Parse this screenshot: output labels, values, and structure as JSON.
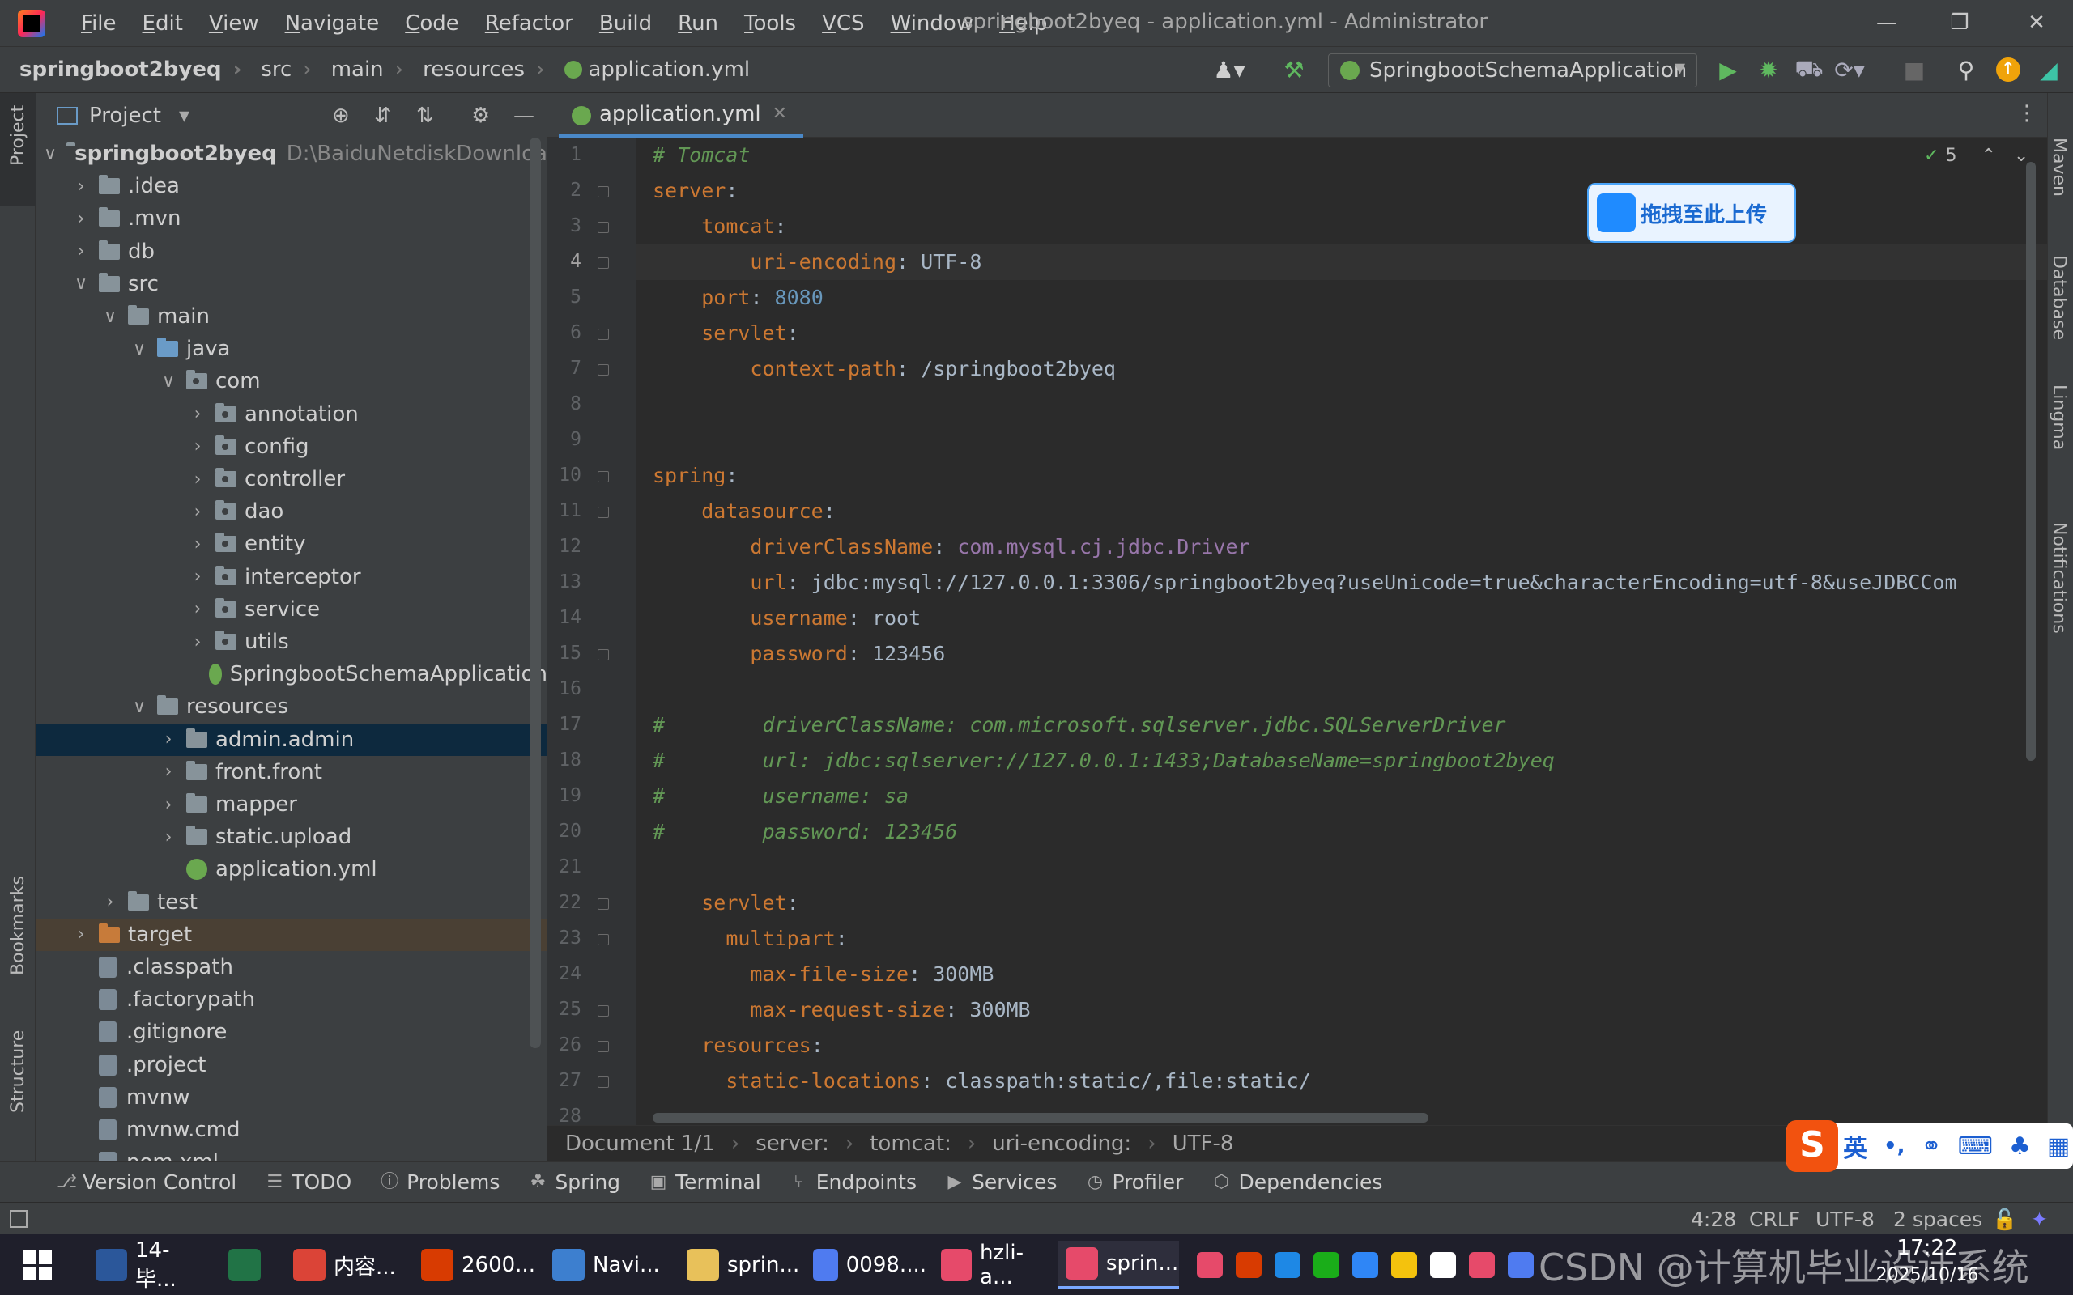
{
  "titlebar": {
    "menu": [
      "File",
      "Edit",
      "View",
      "Navigate",
      "Code",
      "Refactor",
      "Build",
      "Run",
      "Tools",
      "VCS",
      "Window",
      "Help"
    ],
    "title": "springboot2byeq - application.yml - Administrator"
  },
  "navbar": {
    "crumbs": [
      "springboot2byeq",
      "src",
      "main",
      "resources",
      "application.yml"
    ],
    "run_config": "SpringbootSchemaApplication"
  },
  "left_stripe": {
    "project": "Project",
    "bookmarks": "Bookmarks",
    "structure": "Structure"
  },
  "right_stripe": {
    "maven": "Maven",
    "database": "Database",
    "lingma": "Lingma",
    "notifications": "Notifications"
  },
  "project_panel": {
    "title": "Project",
    "tree": [
      {
        "label": "springboot2byeq",
        "extra": "D:\\BaiduNetdiskDownload\\s",
        "depth": 0,
        "expanded": true,
        "kind": "module"
      },
      {
        "label": ".idea",
        "depth": 1,
        "expanded": false,
        "kind": "folder"
      },
      {
        "label": ".mvn",
        "depth": 1,
        "expanded": false,
        "kind": "folder"
      },
      {
        "label": "db",
        "depth": 1,
        "expanded": false,
        "kind": "folder"
      },
      {
        "label": "src",
        "depth": 1,
        "expanded": true,
        "kind": "folder"
      },
      {
        "label": "main",
        "depth": 2,
        "expanded": true,
        "kind": "folder"
      },
      {
        "label": "java",
        "depth": 3,
        "expanded": true,
        "kind": "folder-blue"
      },
      {
        "label": "com",
        "depth": 4,
        "expanded": true,
        "kind": "package"
      },
      {
        "label": "annotation",
        "depth": 5,
        "expanded": false,
        "kind": "package"
      },
      {
        "label": "config",
        "depth": 5,
        "expanded": false,
        "kind": "package"
      },
      {
        "label": "controller",
        "depth": 5,
        "expanded": false,
        "kind": "package"
      },
      {
        "label": "dao",
        "depth": 5,
        "expanded": false,
        "kind": "package"
      },
      {
        "label": "entity",
        "depth": 5,
        "expanded": false,
        "kind": "package"
      },
      {
        "label": "interceptor",
        "depth": 5,
        "expanded": false,
        "kind": "package"
      },
      {
        "label": "service",
        "depth": 5,
        "expanded": false,
        "kind": "package"
      },
      {
        "label": "utils",
        "depth": 5,
        "expanded": false,
        "kind": "package"
      },
      {
        "label": "SpringbootSchemaApplication",
        "depth": 5,
        "kind": "spring"
      },
      {
        "label": "resources",
        "depth": 3,
        "expanded": true,
        "kind": "folder"
      },
      {
        "label": "admin.admin",
        "depth": 4,
        "expanded": false,
        "kind": "folder",
        "selected": true
      },
      {
        "label": "front.front",
        "depth": 4,
        "expanded": false,
        "kind": "folder"
      },
      {
        "label": "mapper",
        "depth": 4,
        "expanded": false,
        "kind": "folder"
      },
      {
        "label": "static.upload",
        "depth": 4,
        "expanded": false,
        "kind": "folder"
      },
      {
        "label": "application.yml",
        "depth": 4,
        "kind": "yml"
      },
      {
        "label": "test",
        "depth": 2,
        "expanded": false,
        "kind": "folder"
      },
      {
        "label": "target",
        "depth": 1,
        "expanded": false,
        "kind": "folder-orange",
        "excluded": true
      },
      {
        "label": ".classpath",
        "depth": 1,
        "kind": "file"
      },
      {
        "label": ".factorypath",
        "depth": 1,
        "kind": "file"
      },
      {
        "label": ".gitignore",
        "depth": 1,
        "kind": "file"
      },
      {
        "label": ".project",
        "depth": 1,
        "kind": "file"
      },
      {
        "label": "mvnw",
        "depth": 1,
        "kind": "file"
      },
      {
        "label": "mvnw.cmd",
        "depth": 1,
        "kind": "file"
      },
      {
        "label": "pom.xml",
        "depth": 1,
        "kind": "file"
      }
    ]
  },
  "editor": {
    "tab": "application.yml",
    "inspection_count": "5",
    "current_line": 4,
    "lines": [
      [
        [
          "c",
          "# Tomcat"
        ]
      ],
      [
        [
          "k",
          "server"
        ],
        [
          "v",
          ":"
        ]
      ],
      [
        [
          "v",
          "    "
        ],
        [
          "k",
          "tomcat"
        ],
        [
          "v",
          ":"
        ]
      ],
      [
        [
          "v",
          "        "
        ],
        [
          "k",
          "uri-encoding"
        ],
        [
          "v",
          ": UTF-8"
        ]
      ],
      [
        [
          "v",
          "    "
        ],
        [
          "k",
          "port"
        ],
        [
          "v",
          ": "
        ],
        [
          "n",
          "8080"
        ]
      ],
      [
        [
          "v",
          "    "
        ],
        [
          "k",
          "servlet"
        ],
        [
          "v",
          ":"
        ]
      ],
      [
        [
          "v",
          "        "
        ],
        [
          "k",
          "context-path"
        ],
        [
          "v",
          ": /springboot2byeq"
        ]
      ],
      [],
      [],
      [
        [
          "k",
          "spring"
        ],
        [
          "v",
          ":"
        ]
      ],
      [
        [
          "v",
          "    "
        ],
        [
          "k",
          "datasource"
        ],
        [
          "v",
          ":"
        ]
      ],
      [
        [
          "v",
          "        "
        ],
        [
          "k",
          "driverClassName"
        ],
        [
          "v",
          ": "
        ],
        [
          "cls",
          "com.mysql.cj.jdbc.Driver"
        ]
      ],
      [
        [
          "v",
          "        "
        ],
        [
          "k",
          "url"
        ],
        [
          "v",
          ": jdbc:mysql://127.0.0.1:3306/springboot2byeq?useUnicode=true&characterEncoding=utf-8&useJDBCCom"
        ]
      ],
      [
        [
          "v",
          "        "
        ],
        [
          "k",
          "username"
        ],
        [
          "v",
          ": root"
        ]
      ],
      [
        [
          "v",
          "        "
        ],
        [
          "k",
          "password"
        ],
        [
          "v",
          ": 123456"
        ]
      ],
      [],
      [
        [
          "c",
          "#        driverClassName: com.microsoft.sqlserver.jdbc.SQLServerDriver"
        ]
      ],
      [
        [
          "c",
          "#        url: jdbc:sqlserver://127.0.0.1:1433;DatabaseName=springboot2byeq"
        ]
      ],
      [
        [
          "c",
          "#        username: sa"
        ]
      ],
      [
        [
          "c",
          "#        password: 123456"
        ]
      ],
      [],
      [
        [
          "v",
          "    "
        ],
        [
          "k",
          "servlet"
        ],
        [
          "v",
          ":"
        ]
      ],
      [
        [
          "v",
          "      "
        ],
        [
          "k",
          "multipart"
        ],
        [
          "v",
          ":"
        ]
      ],
      [
        [
          "v",
          "        "
        ],
        [
          "k",
          "max-file-size"
        ],
        [
          "v",
          ": 300MB"
        ]
      ],
      [
        [
          "v",
          "        "
        ],
        [
          "k",
          "max-request-size"
        ],
        [
          "v",
          ": 300MB"
        ]
      ],
      [
        [
          "v",
          "    "
        ],
        [
          "k",
          "resources"
        ],
        [
          "v",
          ":"
        ]
      ],
      [
        [
          "v",
          "      "
        ],
        [
          "k",
          "static-locations"
        ],
        [
          "v",
          ": classpath:static/,file:static/"
        ]
      ],
      []
    ],
    "breadcrumb": [
      "Document 1/1",
      "server:",
      "tomcat:",
      "uri-encoding:",
      "UTF-8"
    ]
  },
  "baidu_upload": "拖拽至此上传",
  "tool_windows": [
    "Version Control",
    "TODO",
    "Problems",
    "Spring",
    "Terminal",
    "Endpoints",
    "Services",
    "Profiler",
    "Dependencies"
  ],
  "statusbar": {
    "position": "4:28",
    "line_sep": "CRLF",
    "encoding": "UTF-8",
    "indent": "2 spaces"
  },
  "ime": {
    "mode": "英",
    "logo": "S"
  },
  "taskbar": {
    "apps": [
      {
        "label": "14-毕...",
        "color": "#2b579a"
      },
      {
        "label": "",
        "color": "#217346"
      },
      {
        "label": "内容...",
        "color": "#db4437"
      },
      {
        "label": "2600...",
        "color": "#d83b01"
      },
      {
        "label": "Navi...",
        "color": "#3d7fcf"
      },
      {
        "label": "sprin...",
        "color": "#e8c15a"
      },
      {
        "label": "0098....",
        "color": "#4f7bf0"
      },
      {
        "label": "hzli-a...",
        "color": "#e64a6a"
      },
      {
        "label": "sprin...",
        "color": "#e64a6a"
      }
    ],
    "time": "17:22",
    "date": "2025/10/16"
  },
  "watermark": "CSDN @计算机毕业设计系统"
}
